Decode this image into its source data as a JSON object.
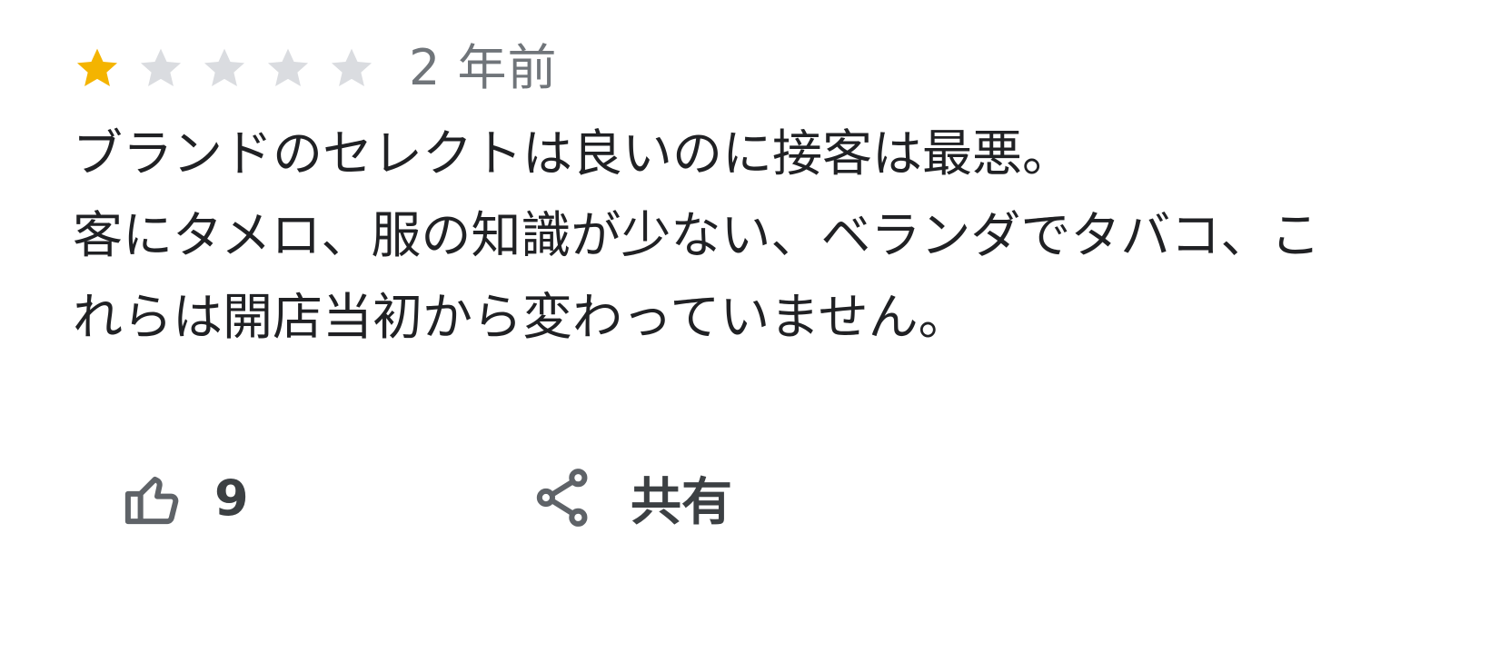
{
  "review": {
    "rating": 1,
    "max_rating": 5,
    "time": "2 年前",
    "text_lines": [
      "ブランドのセレクトは良いのに接客は最悪。",
      "客にタメロ、服の知識が少ない、ベランダでタバコ、こ",
      "れらは開店当初から変わっていません。"
    ]
  },
  "actions": {
    "like_count": "9",
    "share_label": "共有"
  },
  "icons": {
    "star_filled": "star-filled-icon",
    "star_empty": "star-empty-icon",
    "like": "thumbs-up-icon",
    "share": "share-icon"
  },
  "colors": {
    "star_filled": "#f4b400",
    "star_empty": "#dadce0",
    "text": "#202124",
    "secondary": "#70757a",
    "action": "#3c4043"
  }
}
